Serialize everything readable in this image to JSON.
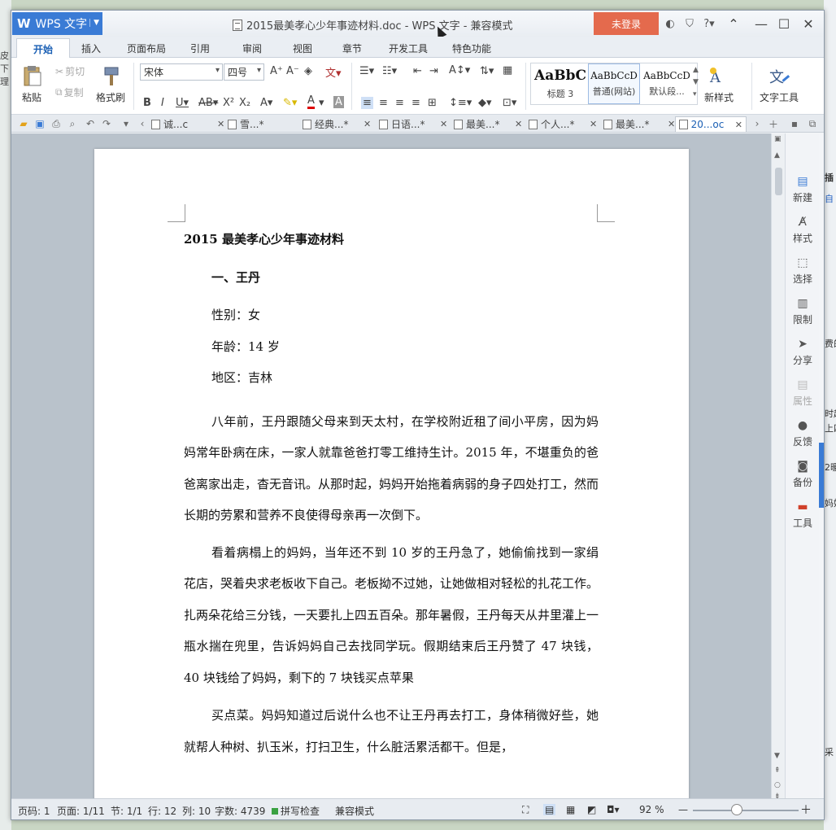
{
  "background": {
    "left_text": [
      "皮下",
      "理"
    ],
    "right_text": [
      "插",
      "自",
      "费的",
      "时起",
      "上四",
      "2暖",
      "妈妈",
      "采"
    ]
  },
  "titlebar": {
    "app_name": "WPS 文字",
    "app_logo": "W",
    "doc_title": "2015最美孝心少年事迹材料.doc - WPS 文字 - 兼容模式",
    "login_label": "未登录",
    "accent_color": "#3a7bd5",
    "login_color": "#e46a4d"
  },
  "menu": {
    "tabs": [
      "开始",
      "插入",
      "页面布局",
      "引用",
      "审阅",
      "视图",
      "章节",
      "开发工具",
      "特色功能"
    ]
  },
  "ribbon": {
    "paste": "粘贴",
    "cut": "剪切",
    "copy": "复制",
    "format_painter": "格式刷",
    "font_name": "宋体",
    "font_size": "四号",
    "styles": [
      {
        "sample": "AaBbC",
        "name": "标题 3"
      },
      {
        "sample": "AaBbCcD",
        "name": "普通(网站)"
      },
      {
        "sample": "AaBbCcD",
        "name": "默认段..."
      }
    ],
    "new_style": "新样式",
    "text_tools": "文字工具"
  },
  "doc_tabs": [
    {
      "label": "诚...c",
      "active": false
    },
    {
      "label": "雪...*",
      "active": false
    },
    {
      "label": "经典...*",
      "active": false
    },
    {
      "label": "日语...*",
      "active": false
    },
    {
      "label": "最美...*",
      "active": false
    },
    {
      "label": "个人...*",
      "active": false
    },
    {
      "label": "最美...*",
      "active": false
    },
    {
      "label": "20...oc",
      "active": true
    }
  ],
  "document": {
    "title": "2015 最美孝心少年事迹材料",
    "section": "一、王丹",
    "fields": [
      "性别：女",
      "年龄：14 岁",
      "地区：吉林"
    ],
    "paragraphs": [
      "八年前，王丹跟随父母来到天太村，在学校附近租了间小平房，因为妈妈常年卧病在床，一家人就靠爸爸打零工维持生计。2015 年，不堪重负的爸爸离家出走，杳无音讯。从那时起，妈妈开始拖着病弱的身子四处打工，然而长期的劳累和营养不良使得母亲再一次倒下。",
      "看着病榻上的妈妈，当年还不到 10 岁的王丹急了，她偷偷找到一家绢花店，哭着央求老板收下自己。老板拗不过她，让她做相对轻松的扎花工作。扎两朵花给三分钱，一天要扎上四五百朵。那年暑假，王丹每天从井里灌上一瓶水揣在兜里，告诉妈妈自己去找同学玩。假期结束后王丹赞了 47 块钱，40 块钱给了妈妈，剩下的 7 块钱买点苹果",
      "买点菜。妈妈知道过后说什么也不让王丹再去打工，身体稍微好些，她就帮人种树、扒玉米，打扫卫生，什么脏活累活都干。但是，"
    ]
  },
  "right_panel": [
    "新建",
    "样式",
    "选择",
    "限制",
    "分享",
    "属性",
    "反馈",
    "备份",
    "工具"
  ],
  "status": {
    "page_code": "页码: 1",
    "pages": "页面: 1/11",
    "section": "节: 1/1",
    "row": "行: 12",
    "col": "列: 10",
    "word_count": "字数: 4739",
    "spell_check": "拼写检查",
    "mode": "兼容模式",
    "zoom": "92 %",
    "zoom_level": 0.5
  }
}
